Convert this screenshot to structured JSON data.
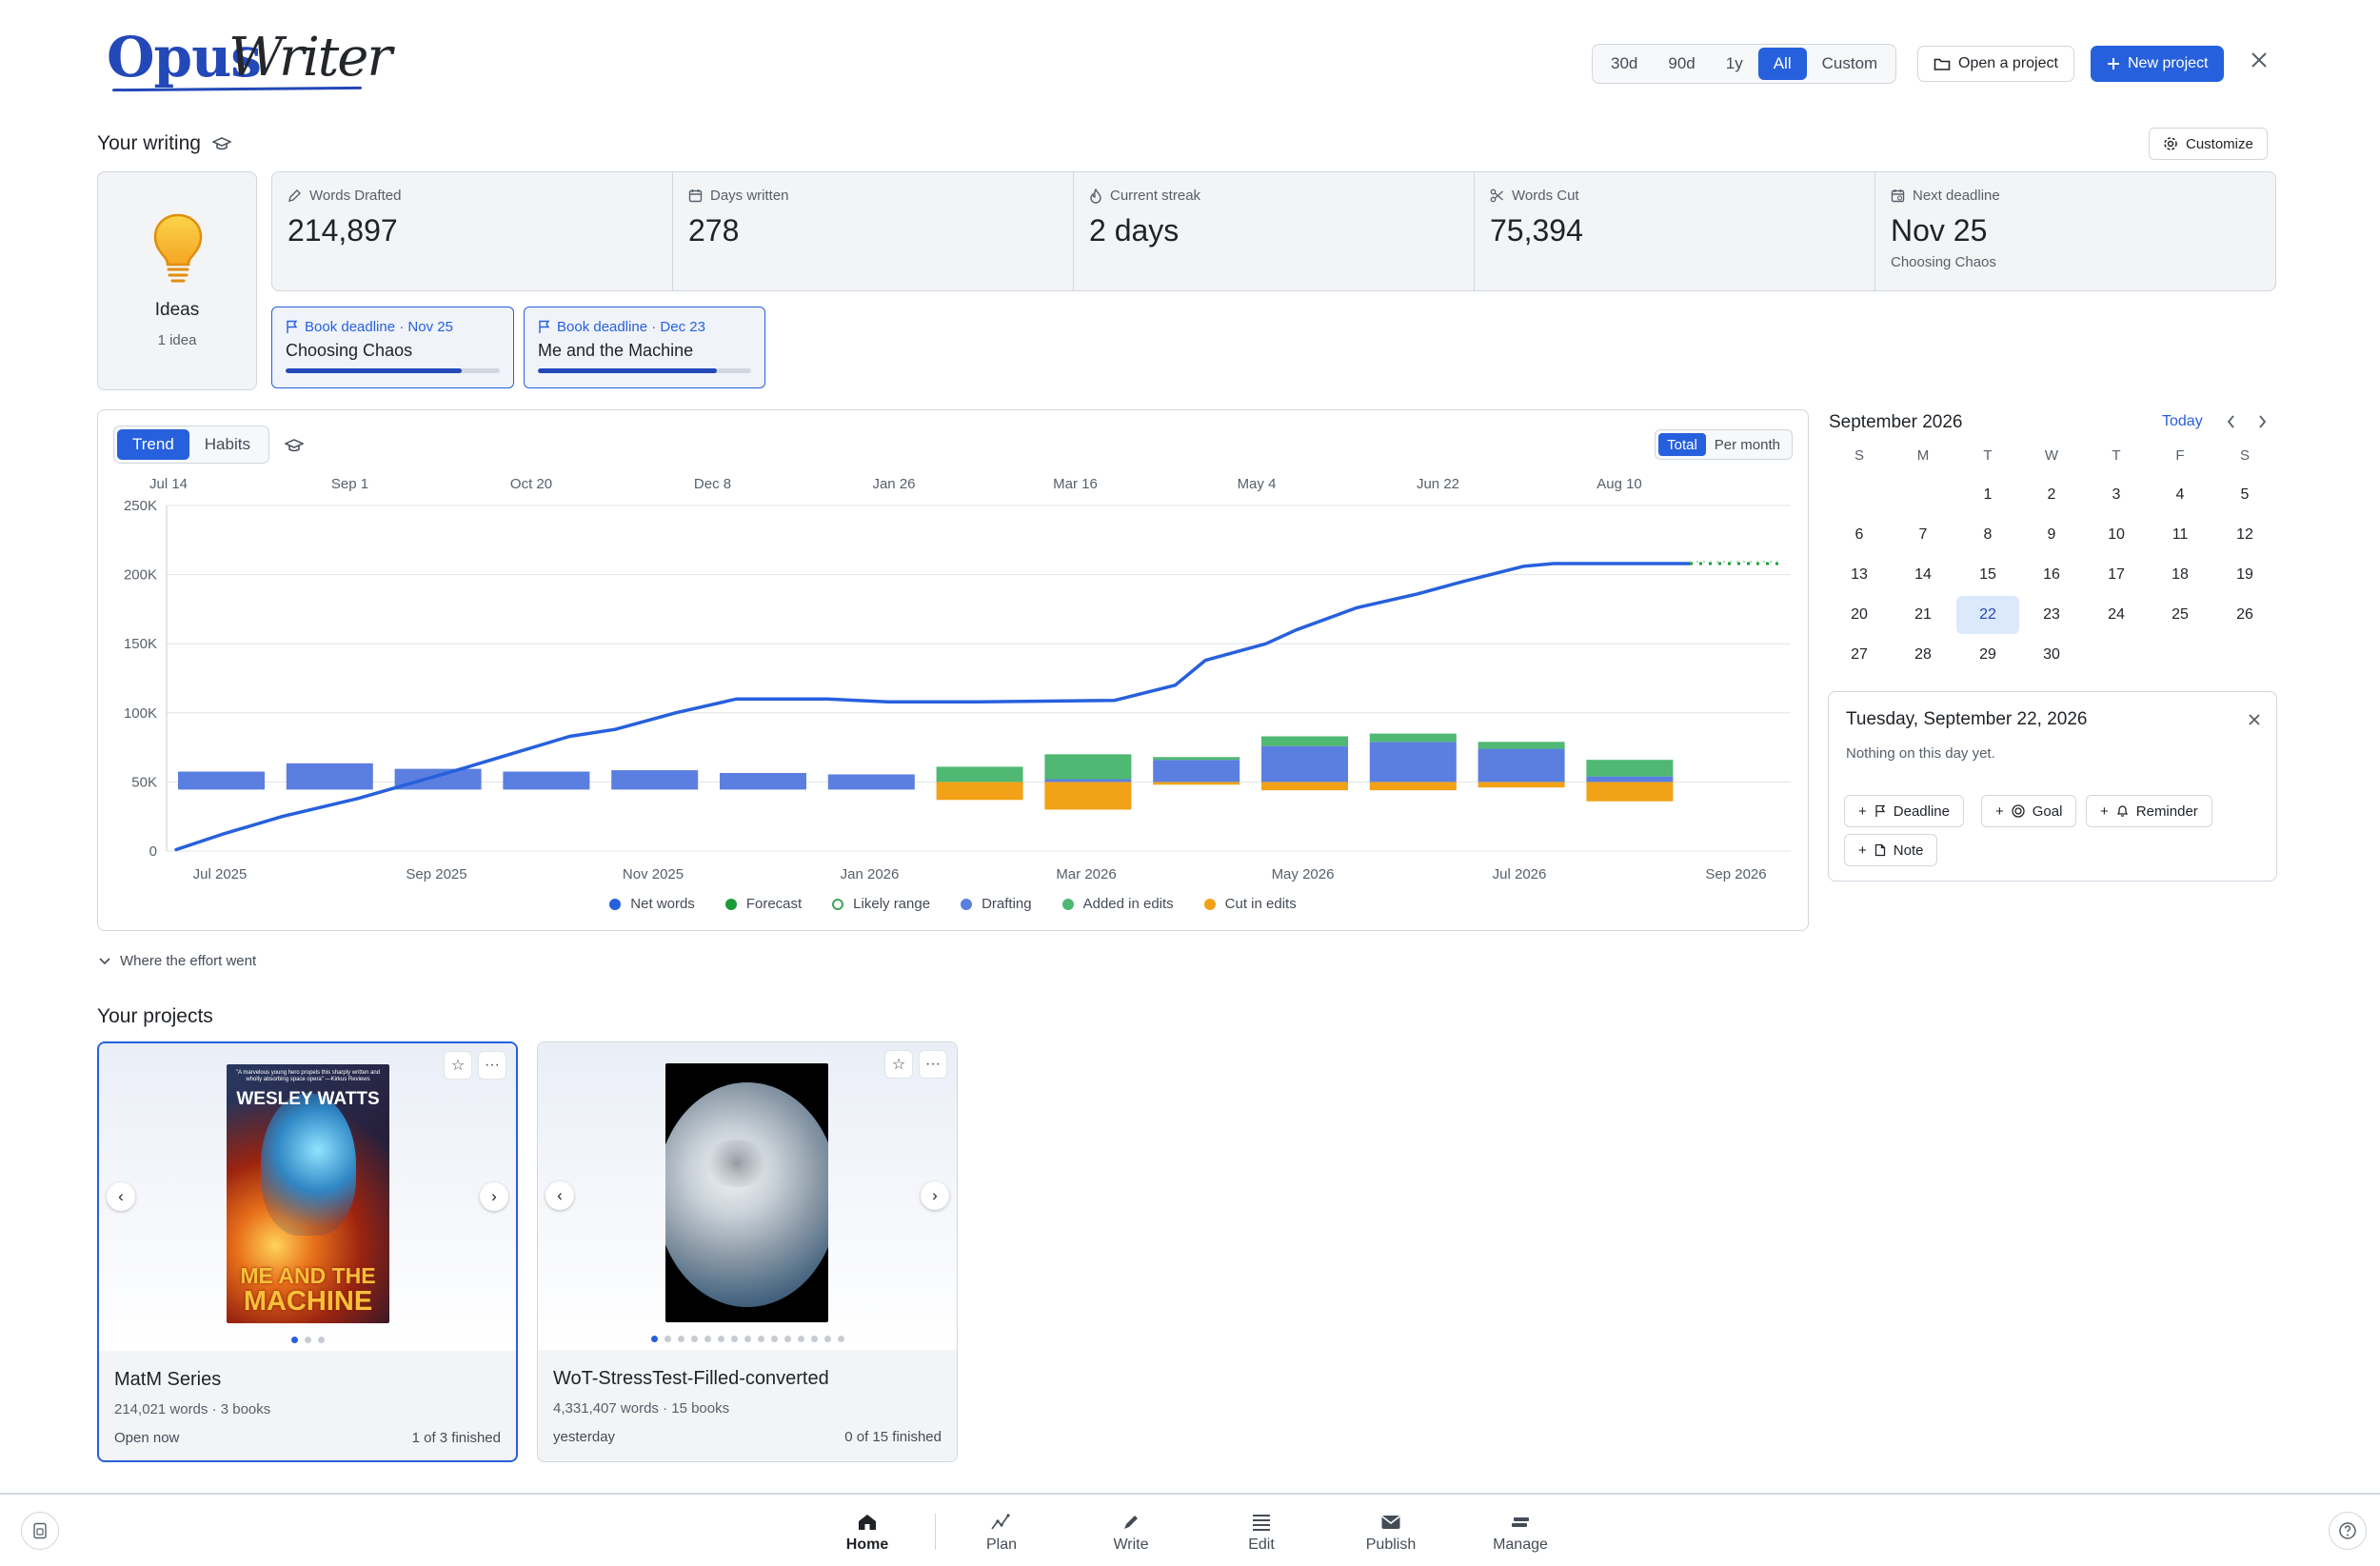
{
  "app": {
    "logo_primary": "Opus",
    "logo_secondary": "Writer"
  },
  "header": {
    "ranges": [
      "30d",
      "90d",
      "1y",
      "All",
      "Custom"
    ],
    "active_range": "All",
    "open_project": "Open a project",
    "new_project": "New project"
  },
  "writing": {
    "title": "Your writing",
    "customize": "Customize",
    "ideas": {
      "label": "Ideas",
      "count": "1 idea"
    },
    "stats": [
      {
        "label": "Words Drafted",
        "value": "214,897",
        "sub": "",
        "icon": "pencil-icon"
      },
      {
        "label": "Days written",
        "value": "278",
        "sub": "",
        "icon": "calendar-icon"
      },
      {
        "label": "Current streak",
        "value": "2 days",
        "sub": "",
        "icon": "flame-icon"
      },
      {
        "label": "Words Cut",
        "value": "75,394",
        "sub": "",
        "icon": "scissors-icon"
      },
      {
        "label": "Next deadline",
        "value": "Nov 25",
        "sub": "Choosing Chaos",
        "icon": "calendar-clock-icon"
      }
    ],
    "deadlines": [
      {
        "head": "Book deadline · Nov 25",
        "title": "Choosing Chaos",
        "progress": 0.82
      },
      {
        "head": "Book deadline · Dec 23",
        "title": "Me and the Machine",
        "progress": 0.84
      }
    ]
  },
  "chart_tabs": {
    "trend": "Trend",
    "habits": "Habits",
    "total": "Total",
    "per_month": "Per month"
  },
  "chart_data": {
    "type": "line",
    "top_axis_labels": [
      "Jul 14",
      "Sep 1",
      "Oct 20",
      "Dec 8",
      "Jan 26",
      "Mar 16",
      "May 4",
      "Jun 22",
      "Aug 10"
    ],
    "bottom_axis_labels": [
      "Jul 2025",
      "Sep 2025",
      "Nov 2025",
      "Jan 2026",
      "Mar 2026",
      "May 2026",
      "Jul 2026",
      "Sep 2026"
    ],
    "y_ticks": [
      "0",
      "50K",
      "100K",
      "150K",
      "200K",
      "250K"
    ],
    "ylim": [
      0,
      250000
    ],
    "grid": true,
    "net_words": {
      "x": [
        0,
        0.03,
        0.07,
        0.12,
        0.19,
        0.26,
        0.29,
        0.33,
        0.37,
        0.43,
        0.47,
        0.53,
        0.62,
        0.66,
        0.68,
        0.72,
        0.74,
        0.78,
        0.82,
        0.85,
        0.89,
        0.91,
        1.0
      ],
      "values": [
        1000,
        12000,
        25000,
        38000,
        60000,
        83000,
        88000,
        100000,
        110000,
        110000,
        108000,
        108000,
        109000,
        120000,
        138000,
        150000,
        160000,
        176000,
        186000,
        195000,
        206000,
        208000,
        208000
      ]
    },
    "forecast": {
      "x": [
        1.0,
        1.06
      ],
      "values": [
        208000,
        208000
      ]
    },
    "bars": [
      {
        "drafting": 13000,
        "added": 0,
        "cut": 0
      },
      {
        "drafting": 19000,
        "added": 0,
        "cut": 0
      },
      {
        "drafting": 15000,
        "added": 0,
        "cut": 0
      },
      {
        "drafting": 13000,
        "added": 0,
        "cut": 0
      },
      {
        "drafting": 14000,
        "added": 0,
        "cut": 0
      },
      {
        "drafting": 12000,
        "added": 0,
        "cut": 0
      },
      {
        "drafting": 11000,
        "added": 0,
        "cut": 0
      },
      {
        "drafting": 0,
        "added": 11000,
        "cut": 13000
      },
      {
        "drafting": 2000,
        "added": 18000,
        "cut": 20000
      },
      {
        "drafting": 16000,
        "added": 2000,
        "cut": 2000
      },
      {
        "drafting": 26000,
        "added": 7000,
        "cut": 6000
      },
      {
        "drafting": 29000,
        "added": 6000,
        "cut": 6000
      },
      {
        "drafting": 24000,
        "added": 5000,
        "cut": 4000
      },
      {
        "drafting": 4000,
        "added": 12000,
        "cut": 14000
      }
    ],
    "legend": [
      {
        "label": "Net words",
        "color": "#2660dc",
        "style": "solid"
      },
      {
        "label": "Forecast",
        "color": "#1a9b3a",
        "style": "solid"
      },
      {
        "label": "Likely range",
        "color": "#3aa65a",
        "style": "ring"
      },
      {
        "label": "Drafting",
        "color": "#5b7fe0",
        "style": "solid"
      },
      {
        "label": "Added in edits",
        "color": "#4fb872",
        "style": "solid"
      },
      {
        "label": "Cut in edits",
        "color": "#f2a216",
        "style": "solid"
      }
    ]
  },
  "effort_toggle": "Where the effort went",
  "calendar": {
    "month": "September 2026",
    "today": "Today",
    "weekdays": [
      "S",
      "M",
      "T",
      "W",
      "T",
      "F",
      "S"
    ],
    "start_offset": 2,
    "days_in_month": 30,
    "selected_day": 22
  },
  "day_panel": {
    "title": "Tuesday, September 22, 2026",
    "subtitle": "Nothing on this day yet.",
    "chips": [
      "Deadline",
      "Goal",
      "Reminder",
      "Note"
    ]
  },
  "projects": {
    "title": "Your projects",
    "items": [
      {
        "name": "MatM Series",
        "meta": "214,021 words · 3 books",
        "when": "Open now",
        "finished": "1 of 3 finished",
        "dots": 3,
        "cover_author": "WESLEY WATTS",
        "cover_title_1": "ME AND THE",
        "cover_title_2": "MACHINE",
        "cover_blurb": "\"A marvelous young hero propels this sharply written and wholly absorbing space opera\" —Kirkus Reviews"
      },
      {
        "name": "WoT-StressTest-Filled-converted",
        "meta": "4,331,407 words · 15 books",
        "when": "yesterday",
        "finished": "0 of 15 finished",
        "dots": 15
      }
    ]
  },
  "bottom_nav": {
    "items": [
      "Home",
      "Plan",
      "Write",
      "Edit",
      "Publish",
      "Manage"
    ],
    "active": "Home"
  }
}
